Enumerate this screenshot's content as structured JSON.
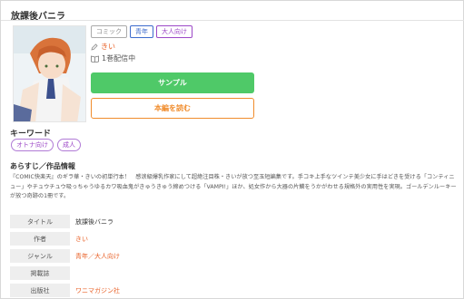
{
  "title": "放課後バニラ",
  "tags": [
    "コミック",
    "青年",
    "大人向け"
  ],
  "author": "きい",
  "volume_status": "1巻配信中",
  "buttons": {
    "sample": "サンプル",
    "read": "本編を読む"
  },
  "keywords": {
    "heading": "キーワード",
    "items": [
      "オトナ向け",
      "成人"
    ]
  },
  "synopsis": {
    "heading": "あらすじ／作品情報",
    "text": "『COMIC快楽天』のギラ華・きいの初単行本！　感涙級爆乳作家にして超絶注目株・きいが放つ至玉短編集です。手コキ上手なツインテ美少女に手はどきを受ける「コンティニュー」やチュウチュウ吸っちゃうゆるカワ吸血鬼がきゅうきゅう締めつける「VAMPI!」ほか、処女作から大器の片鱗をうかがわせる規格外の実用性を実現。ゴールデンルーキーが放つ奇跡の1冊です。"
  },
  "info": [
    {
      "label": "タイトル",
      "value": "放課後バニラ"
    },
    {
      "label": "作者",
      "value": "きい"
    },
    {
      "label": "ジャンル",
      "value": "青年／大人向け"
    },
    {
      "label": "掲載誌",
      "value": ""
    },
    {
      "label": "出版社",
      "value": "ワニマガジン社"
    }
  ],
  "colors": {
    "accent": "#e9632a",
    "sample_btn": "#4fc968",
    "read_btn": "#f08c2c",
    "tag_purple": "#9c48c7",
    "tag_blue": "#3d6bcc"
  },
  "icons": {
    "author": "pencil-icon",
    "volume": "book-icon"
  }
}
